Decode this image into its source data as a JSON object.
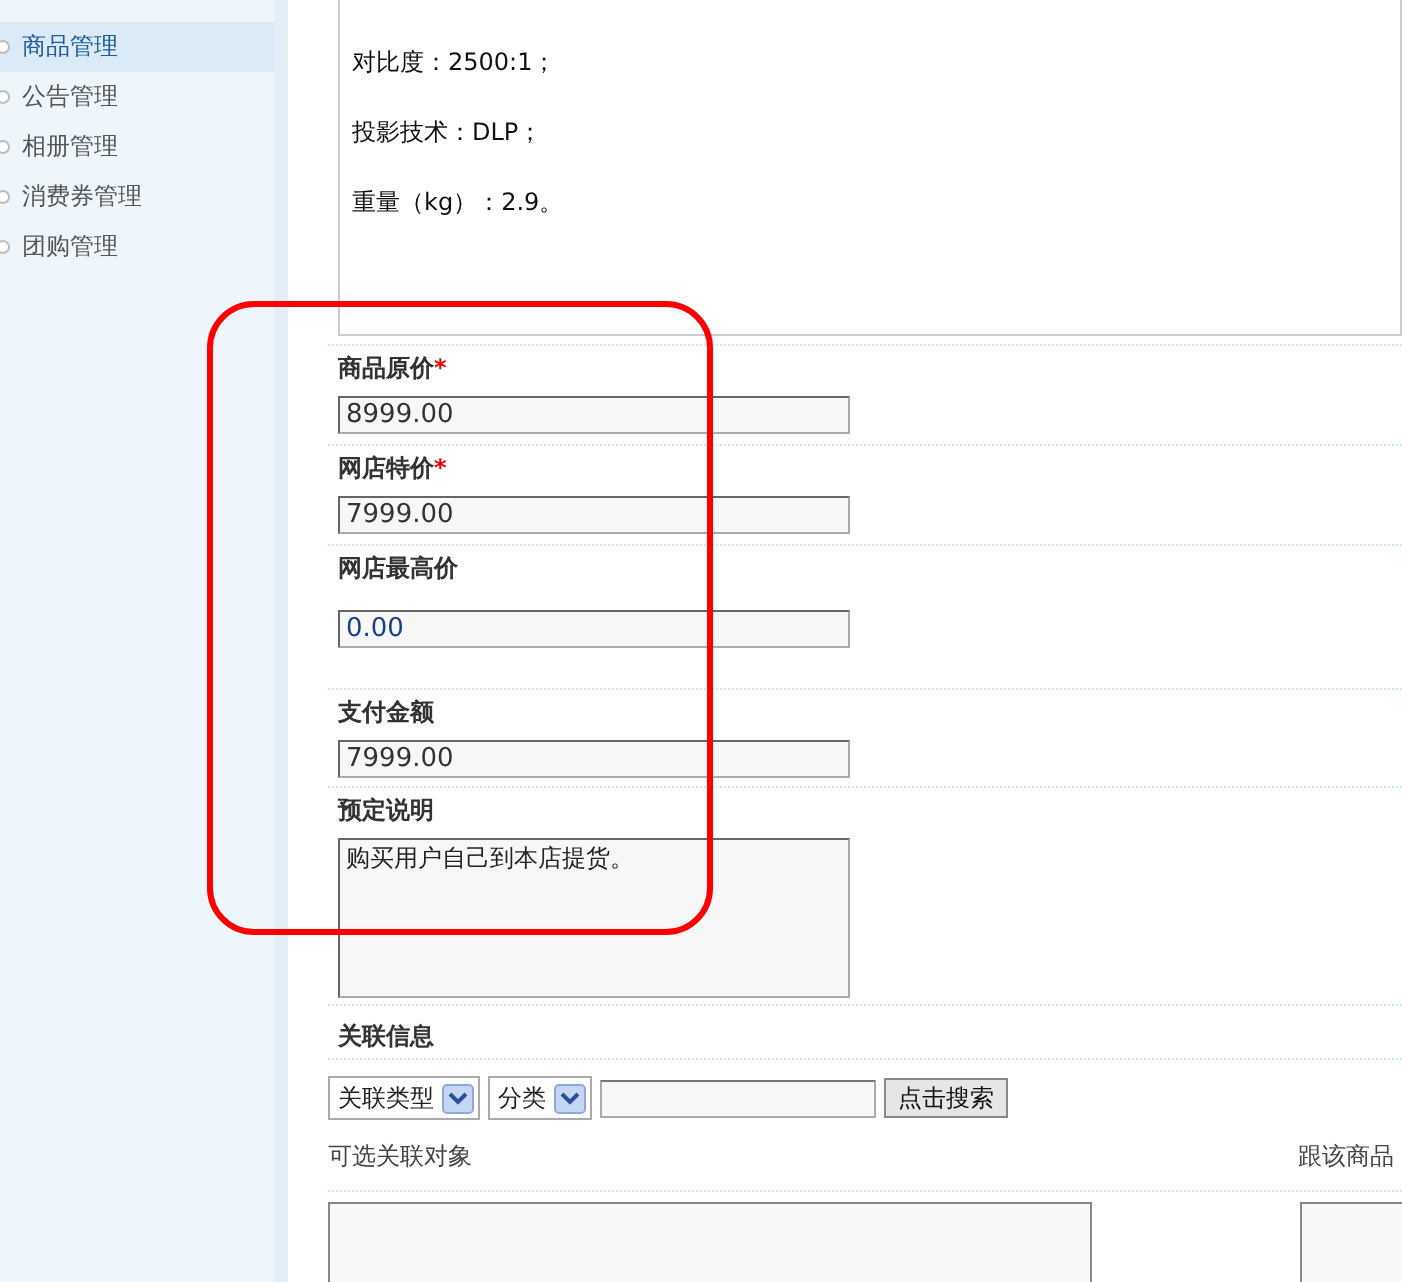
{
  "sidebar": {
    "items": [
      {
        "label": "商品管理",
        "selected": true
      },
      {
        "label": "公告管理",
        "selected": false
      },
      {
        "label": "相册管理",
        "selected": false
      },
      {
        "label": "消费券管理",
        "selected": false
      },
      {
        "label": "团购管理",
        "selected": false
      }
    ]
  },
  "description": {
    "lines": [
      "对比度：2500:1；",
      "投影技术：DLP；",
      "重量（kg）：2.9。"
    ]
  },
  "fields": [
    {
      "kind": "input",
      "label": "商品原价",
      "mark": "*",
      "value": "8999.00"
    },
    {
      "kind": "input",
      "label": "网店特价",
      "mark": "*",
      "value": "7999.00"
    },
    {
      "kind": "input-spaced",
      "label": "网店最高价",
      "value": "0.00"
    },
    {
      "kind": "input",
      "label": "支付金额",
      "value": "7999.00"
    },
    {
      "kind": "textarea",
      "label": "预定说明",
      "value": "购买用户自己到本店提货。"
    }
  ],
  "relation": {
    "title": "关联信息",
    "selects": [
      "关联类型",
      "分类"
    ],
    "search_button": "点击搜索",
    "available_label": "可选关联对象",
    "linked_label": "跟该商品"
  },
  "annotation": {
    "kind": "rounded-rectangle"
  }
}
